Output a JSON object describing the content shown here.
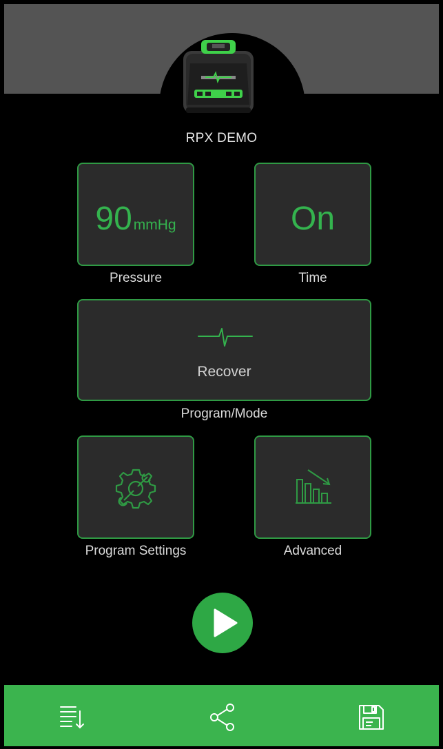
{
  "device": {
    "name": "RPX DEMO",
    "image_icon": "pump-device-icon"
  },
  "tiles": {
    "pressure": {
      "value": "90",
      "unit": "mmHg",
      "caption": "Pressure"
    },
    "time": {
      "value": "On",
      "caption": "Time"
    },
    "program_mode": {
      "value": "Recover",
      "caption": "Program/Mode",
      "icon": "heartbeat-icon"
    },
    "program_settings": {
      "caption": "Program Settings",
      "icon": "gear-wrench-icon"
    },
    "advanced": {
      "caption": "Advanced",
      "icon": "bar-chart-trend-icon"
    }
  },
  "actions": {
    "play_icon": "play-icon"
  },
  "bottom_bar": [
    {
      "icon": "list-sort-icon"
    },
    {
      "icon": "share-icon"
    },
    {
      "icon": "save-icon"
    }
  ],
  "colors": {
    "accent": "#2ea845",
    "accent_text": "#34b34e",
    "tile_bg": "#2b2b2b",
    "header_gray": "#545454",
    "bottom_bar": "#3bb44e"
  }
}
